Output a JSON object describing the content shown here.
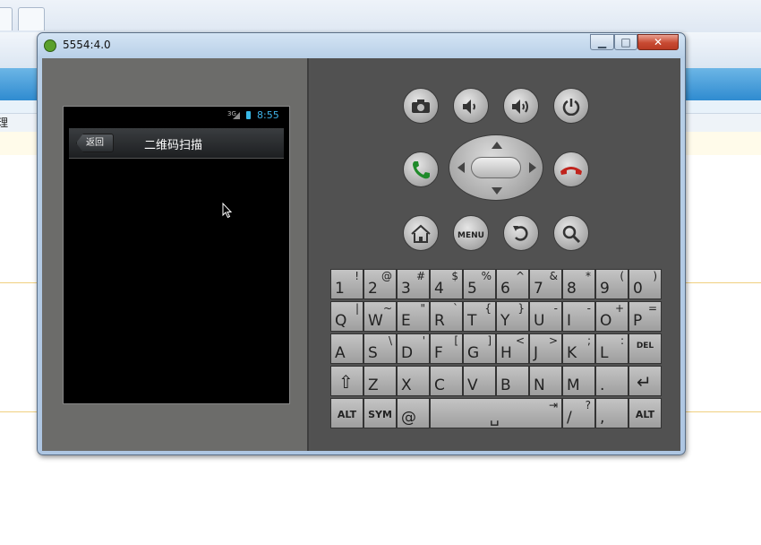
{
  "window": {
    "title": "5554:4.0"
  },
  "background": {
    "row_text": "理"
  },
  "phone": {
    "status": {
      "signal_text": "3G",
      "time": "8:55"
    },
    "appbar": {
      "back_label": "返回",
      "title": "二维码扫描"
    }
  },
  "controls": {
    "menu_label": "MENU",
    "buttons": [
      {
        "name": "camera",
        "icon": "camera-icon"
      },
      {
        "name": "volume-down",
        "icon": "volume-down-icon"
      },
      {
        "name": "volume-up",
        "icon": "volume-up-icon"
      },
      {
        "name": "power",
        "icon": "power-icon"
      },
      {
        "name": "call",
        "icon": "call-icon"
      },
      {
        "name": "end-call",
        "icon": "end-call-icon"
      },
      {
        "name": "home",
        "icon": "home-icon"
      },
      {
        "name": "menu",
        "icon": "menu-icon"
      },
      {
        "name": "back",
        "icon": "back-icon"
      },
      {
        "name": "search",
        "icon": "search-icon"
      }
    ]
  },
  "keyboard": {
    "rows": [
      [
        {
          "m": "1",
          "a": "!"
        },
        {
          "m": "2",
          "a": "@"
        },
        {
          "m": "3",
          "a": "#"
        },
        {
          "m": "4",
          "a": "$"
        },
        {
          "m": "5",
          "a": "%"
        },
        {
          "m": "6",
          "a": "^"
        },
        {
          "m": "7",
          "a": "&"
        },
        {
          "m": "8",
          "a": "*"
        },
        {
          "m": "9",
          "a": "("
        },
        {
          "m": "0",
          "a": ")"
        }
      ],
      [
        {
          "m": "Q",
          "a": "|"
        },
        {
          "m": "W",
          "a": "~"
        },
        {
          "m": "E",
          "a": "\""
        },
        {
          "m": "R",
          "a": "`"
        },
        {
          "m": "T",
          "a": "{"
        },
        {
          "m": "Y",
          "a": "}"
        },
        {
          "m": "U",
          "a": "-"
        },
        {
          "m": "I",
          "a": "-"
        },
        {
          "m": "O",
          "a": "+"
        },
        {
          "m": "P",
          "a": "="
        }
      ],
      [
        {
          "m": "A",
          "a": ""
        },
        {
          "m": "S",
          "a": "\\"
        },
        {
          "m": "D",
          "a": "'"
        },
        {
          "m": "F",
          "a": "["
        },
        {
          "m": "G",
          "a": "]"
        },
        {
          "m": "H",
          "a": "<"
        },
        {
          "m": "J",
          "a": ">"
        },
        {
          "m": "K",
          "a": ";"
        },
        {
          "m": "L",
          "a": ":"
        },
        {
          "m": "DEL",
          "a": ""
        }
      ],
      [
        {
          "m": "⇧",
          "a": ""
        },
        {
          "m": "Z",
          "a": ""
        },
        {
          "m": "X",
          "a": ""
        },
        {
          "m": "C",
          "a": ""
        },
        {
          "m": "V",
          "a": ""
        },
        {
          "m": "B",
          "a": ""
        },
        {
          "m": "N",
          "a": ""
        },
        {
          "m": "M",
          "a": ""
        },
        {
          "m": ".",
          "a": ""
        },
        {
          "m": "↵",
          "a": ""
        }
      ],
      [
        {
          "m": "ALT",
          "a": ""
        },
        {
          "m": "SYM",
          "a": ""
        },
        {
          "m": "@",
          "a": ""
        },
        {
          "m": "␣",
          "a": "⇥"
        },
        {
          "m": "/",
          "a": "?"
        },
        {
          "m": ",",
          "a": ""
        },
        {
          "m": "ALT",
          "a": ""
        }
      ]
    ]
  },
  "colors": {
    "clock": "#3fb4ea",
    "call_green": "#1f8a2a",
    "end_red": "#c0231c"
  }
}
